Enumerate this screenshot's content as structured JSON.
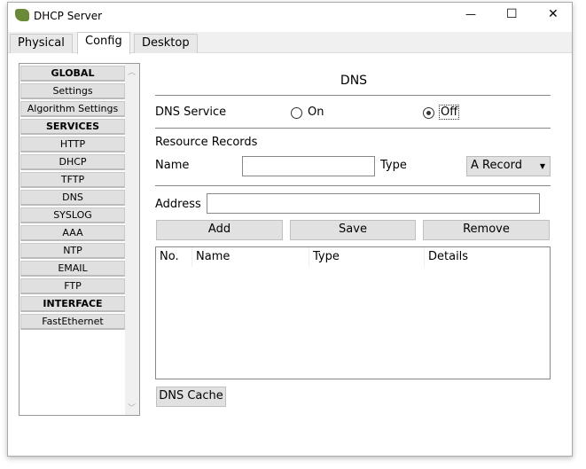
{
  "window": {
    "title": "DHCP Server",
    "minimize": "—",
    "maximize": "☐",
    "close": "✕"
  },
  "tabs": [
    {
      "label": "Physical"
    },
    {
      "label": "Config"
    },
    {
      "label": "Desktop"
    }
  ],
  "sidebar": {
    "items": [
      {
        "label": "GLOBAL",
        "header": true
      },
      {
        "label": "Settings"
      },
      {
        "label": "Algorithm Settings"
      },
      {
        "label": "SERVICES",
        "header": true
      },
      {
        "label": "HTTP"
      },
      {
        "label": "DHCP"
      },
      {
        "label": "TFTP"
      },
      {
        "label": "DNS"
      },
      {
        "label": "SYSLOG"
      },
      {
        "label": "AAA"
      },
      {
        "label": "NTP"
      },
      {
        "label": "EMAIL"
      },
      {
        "label": "FTP"
      },
      {
        "label": "INTERFACE",
        "header": true
      },
      {
        "label": "FastEthernet"
      }
    ]
  },
  "dns": {
    "title": "DNS",
    "service_label": "DNS Service",
    "on_label": "On",
    "off_label": "Off",
    "selected": "Off",
    "resource_records": "Resource Records",
    "name_label": "Name",
    "name_value": "",
    "type_label": "Type",
    "type_value": "A Record",
    "address_label": "Address",
    "address_value": "",
    "add": "Add",
    "save": "Save",
    "remove": "Remove",
    "columns": [
      "No.",
      "Name",
      "Type",
      "Details"
    ],
    "rows": [],
    "cache": "DNS Cache"
  }
}
